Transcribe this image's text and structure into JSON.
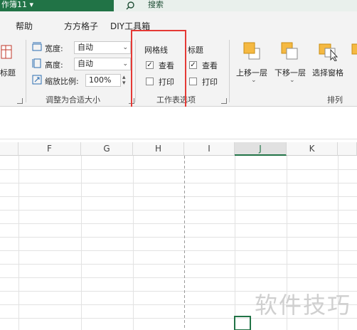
{
  "window": {
    "title": "作簿11 ▾"
  },
  "search": {
    "label": "搜索"
  },
  "tabs": [
    "帮助",
    "方方格子",
    "DIY工具箱"
  ],
  "ribbon": {
    "print_titles_label": "标题",
    "scale_group": {
      "width_label": "宽度:",
      "width_value": "自动",
      "height_label": "高度:",
      "height_value": "自动",
      "scale_label": "缩放比例:",
      "scale_value": "100%",
      "group_label": "调整为合适大小"
    },
    "sheet_options": {
      "gridlines_header": "网格线",
      "headings_header": "标题",
      "view_label": "查看",
      "print_label": "打印",
      "gridlines_view": true,
      "gridlines_print": false,
      "headings_view": true,
      "headings_print": false,
      "group_label": "工作表选项"
    },
    "arrange": {
      "bring_forward": "上移一层",
      "send_backward": "下移一层",
      "selection_pane": "选择窗格",
      "group_label": "排列"
    }
  },
  "grid": {
    "columns": [
      "F",
      "G",
      "H",
      "I",
      "J",
      "K"
    ],
    "selected_column": "J"
  },
  "watermark": "软件技巧",
  "colors": {
    "accent": "#217346",
    "highlight": "#e53935"
  }
}
